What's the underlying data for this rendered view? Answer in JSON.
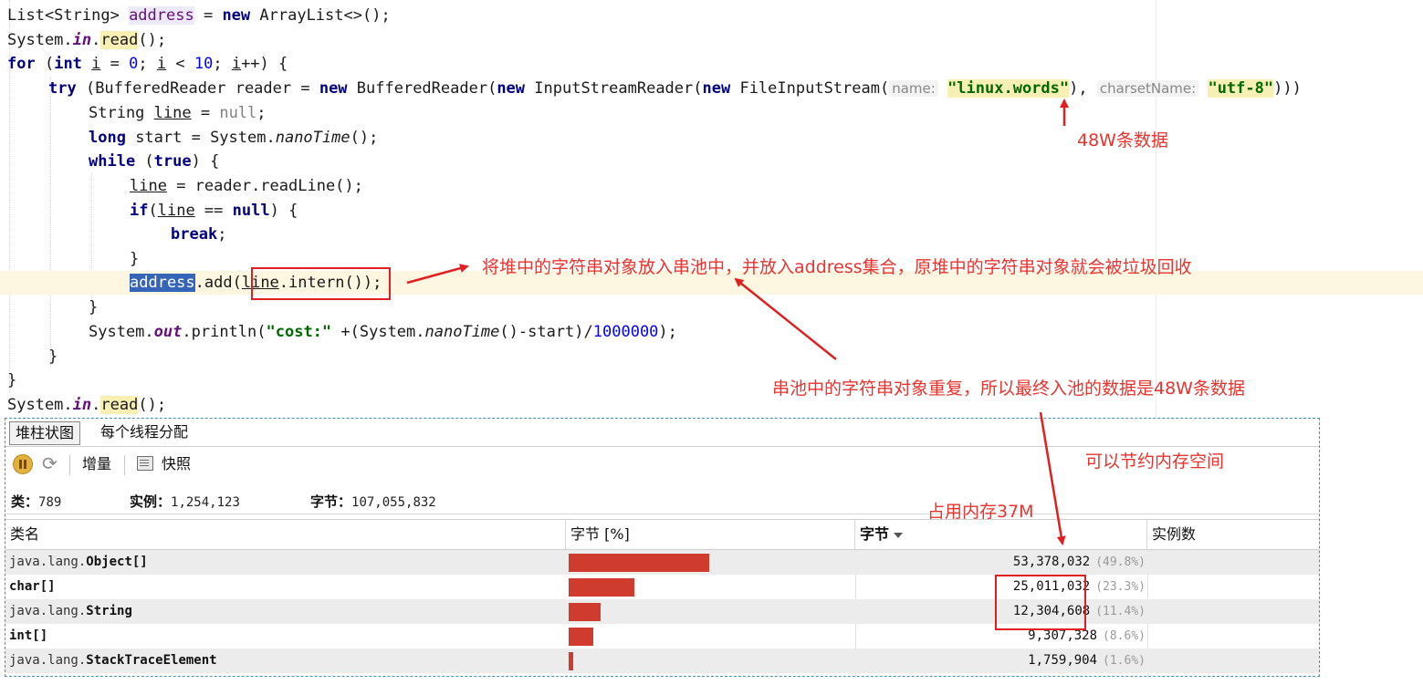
{
  "editor": {
    "line1": {
      "a": "List<String> ",
      "b": "address",
      "c": " = ",
      "d": "new",
      "e": " ArrayList<>();"
    },
    "line2": {
      "a": "System.",
      "b": "in",
      "c": ".",
      "d": "read",
      "e": "();"
    },
    "line3": {
      "a": "for",
      "b": " (",
      "c": "int",
      "d": " ",
      "e": "i",
      "f": " = ",
      "g": "0",
      "h": "; ",
      "i": "i",
      "j": " < ",
      "k": "10",
      "l": "; ",
      "m": "i",
      "n": "++) {"
    },
    "line4": {
      "a": "try",
      "b": " (BufferedReader reader = ",
      "c": "new",
      "d": " BufferedReader(",
      "e": "new",
      "f": " InputStreamReader(",
      "g": "new",
      "h": " FileInputStream(",
      "p1": "name:",
      "s1": "\"linux.words\"",
      "i": "), ",
      "p2": "charsetName:",
      "s2": "\"utf-8\"",
      "j": ")))"
    },
    "line5": {
      "a": "String ",
      "b": "line",
      "c": " = ",
      "d": "null",
      "e": ";"
    },
    "line6": {
      "a": "long",
      "b": " start = System.",
      "c": "nanoTime",
      "d": "();"
    },
    "line7": {
      "a": "while",
      "b": " (",
      "c": "true",
      "d": ") {"
    },
    "line8": {
      "a": "line",
      "b": " = reader.readLine();"
    },
    "line9": {
      "a": "if",
      "b": "(",
      "c": "line",
      "d": " == ",
      "e": "null",
      "f": ") {"
    },
    "line10": {
      "a": "break",
      "b": ";"
    },
    "line11": {
      "a": "}"
    },
    "line12": {
      "a": "address",
      "b": ".add(",
      "c": "line",
      "d": ".intern()",
      "e": ");"
    },
    "line13": {
      "a": "}"
    },
    "line14": {
      "a": "System.",
      "b": "out",
      "c": ".println(",
      "d": "\"cost:\"",
      "e": " +(System.",
      "f": "nanoTime",
      "g": "()-start)/",
      "h": "1000000",
      "i": ");"
    },
    "line15": {
      "a": "}"
    },
    "line16": {
      "a": "}"
    },
    "line17": {
      "a": "System.",
      "b": "in",
      "c": ".",
      "d": "read",
      "e": "();"
    }
  },
  "annotations": {
    "data_count": "48W条数据",
    "intern_note": "将堆中的字符串对象放入串池中，并放入address集合，原堆中的字符串对象就会被垃圾回收",
    "pool_note": "串池中的字符串对象重复，所以最终入池的数据是48W条数据",
    "save_note": "可以节约内存空间",
    "mem_note": "占用内存37M",
    "color": "#e8342e"
  },
  "profiler": {
    "tabs": [
      "堆柱状图",
      "每个线程分配"
    ],
    "toolbar": {
      "delta": "增量",
      "snapshot": "快照"
    },
    "summary": {
      "classes_label": "类：",
      "classes_value": "789",
      "instances_label": "实例：",
      "instances_value": "1,254,123",
      "bytes_label": "字节：",
      "bytes_value": "107,055,832"
    },
    "columns": {
      "name": "类名",
      "bytes_bar": "字节 [%]",
      "bytes": "字节",
      "instances": "实例数"
    },
    "rows": [
      {
        "pkg": "java.lang.",
        "cls": "Object[]",
        "bytes": "53,378,032",
        "pct": "(49.8%)",
        "fraction": 0.498
      },
      {
        "pkg": "",
        "cls": "char[]",
        "bytes": "25,011,032",
        "pct": "(23.3%)",
        "fraction": 0.233
      },
      {
        "pkg": "java.lang.",
        "cls": "String",
        "bytes": "12,304,608",
        "pct": "(11.4%)",
        "fraction": 0.114
      },
      {
        "pkg": "",
        "cls": "int[]",
        "bytes": "9,307,328",
        "pct": "(8.6%)",
        "fraction": 0.086
      },
      {
        "pkg": "java.lang.",
        "cls": "StackTraceElement",
        "bytes": "1,759,904",
        "pct": "(1.6%)",
        "fraction": 0.016
      }
    ]
  }
}
